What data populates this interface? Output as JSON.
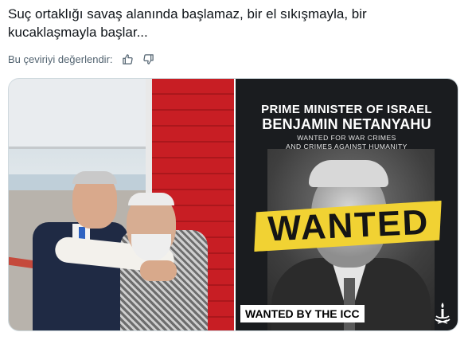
{
  "tweet": {
    "text": "Suç ortaklığı savaş alanında başlamaz, bir el sıkışmayla, bir kucaklaşmayla başlar..."
  },
  "translation": {
    "rate_label": "Bu çeviriyi değerlendir:",
    "thumbs_up_icon": "thumbs-up-icon",
    "thumbs_down_icon": "thumbs-down-icon"
  },
  "media": {
    "poster": {
      "title": "PRIME MINISTER OF ISRAEL",
      "name": "BENJAMIN NETANYAHU",
      "sub_line1": "WANTED FOR WAR CRIMES",
      "sub_line2": "AND CRIMES AGAINST HUMANITY",
      "stamp": "WANTED",
      "footer": "WANTED BY THE ICC",
      "accent_color": "#f1d233"
    }
  }
}
